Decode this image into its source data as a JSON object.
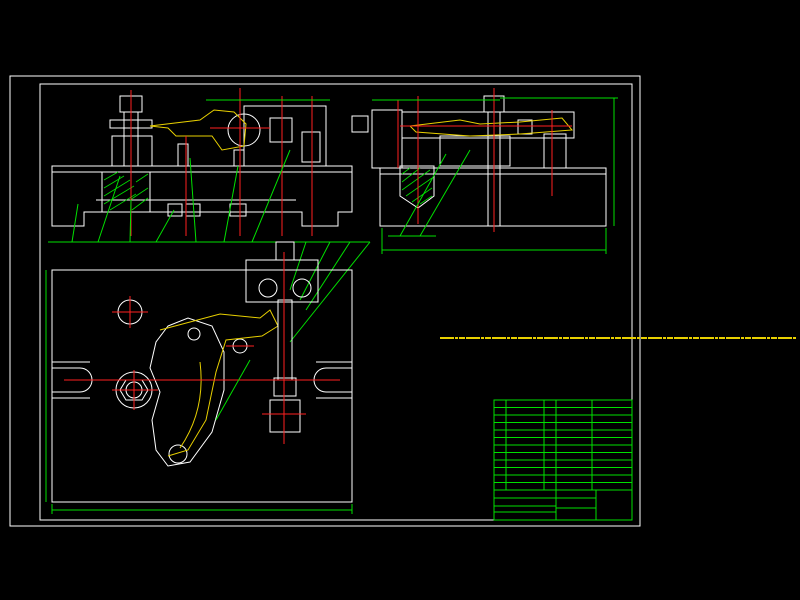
{
  "drawing": {
    "background": "#000000",
    "colors": {
      "outline": "#ffffff",
      "dimension": "#00e000",
      "centerline": "#ff2020",
      "clamp": "#e8d000",
      "note_text": "#e8d000"
    },
    "views": [
      "front-view",
      "side-view",
      "top-view"
    ],
    "balloons": [
      "",
      "",
      "",
      "",
      "",
      "",
      "",
      "",
      "",
      "",
      "",
      "",
      "",
      ""
    ],
    "note_text": "",
    "title_block": {
      "rows": 12,
      "cols": 6
    }
  }
}
